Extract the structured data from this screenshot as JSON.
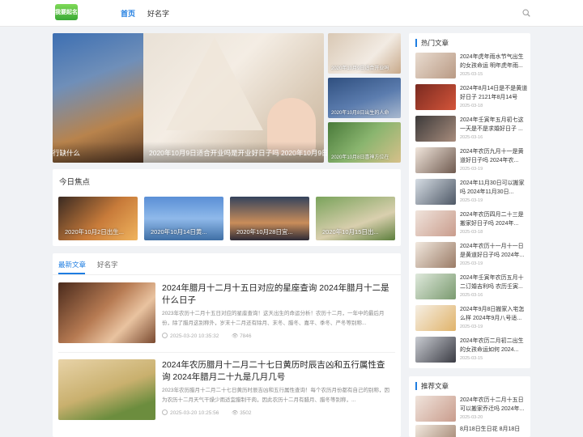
{
  "header": {
    "logo_text": "我要起名",
    "nav": [
      {
        "label": "首页",
        "active": true
      },
      {
        "label": "好名字",
        "active": false
      }
    ]
  },
  "slider": {
    "main_caption_left": "行缺什么",
    "main_caption_right": "2020年10月9日适合开业吗是开业好日子吗 2020年10月9日",
    "thumbs": [
      "2020年10月9日适合开业吗",
      "2020年10月8日出生的人命",
      "2020年10月8日喜神方位在"
    ]
  },
  "focus": {
    "title": "今日焦点",
    "cards": [
      "2020年10月2日出生...",
      "2020年10月14日黄...",
      "2020年10月28日宜...",
      "2020年10月15日出..."
    ]
  },
  "article_list": {
    "tabs": [
      {
        "label": "最新文章",
        "active": true
      },
      {
        "label": "好名字",
        "active": false
      }
    ],
    "articles": [
      {
        "title": "2024年腊月十二月十五日对应的星座查询 2024年腊月十二是什么日子",
        "desc": "2023年农历十二月十五日对应的星座查询！这天出生的命运分析！农历十二月，一年中的最后月份，除了腊月这别称外，岁末十二月还有除月、末冬、腊冬、嘉平、季冬、严冬等别称...",
        "date": "2025-03-20 10:35:32",
        "views": "7846"
      },
      {
        "title": "2024年农历腊月十二月二十七日黄历时辰吉凶和五行属性查询 2024年腊月二十九是几月几号",
        "desc": "2023年农历腊月十二月二十七日黄历时辰吉凶和五行属性查询！每个农历月份都有自己的别称，因为农历十二月天气干燥少雨适宜腊制干肉，因此农历十二月有腊月、腊冬等别称，...",
        "date": "2025-03-20 10:25:56",
        "views": "3502"
      }
    ]
  },
  "sidebar_hot": {
    "title": "热门文章",
    "items": [
      {
        "title": "2024年虎年雨水节气出生的女孩命运 明年虎年雨...",
        "date": "2025-03-15"
      },
      {
        "title": "2024年8月14日是不是黄道好日子 2121年8月14号",
        "date": "2025-03-18"
      },
      {
        "title": "2024年壬寅年五月初七这一天是不是求婚好日子 ...",
        "date": "2025-03-16"
      },
      {
        "title": "2024年农历九月十一是黄道好日子吗 2024年农...",
        "date": "2025-03-19"
      },
      {
        "title": "2024年11月30日可以搬家吗 2024年11月30日...",
        "date": "2025-03-19"
      },
      {
        "title": "2024年农历四月二十三是搬家好日子吗 2024年...",
        "date": "2025-03-18"
      },
      {
        "title": "2024年农历十一月十一日是黄道好日子吗 2024年...",
        "date": "2025-03-19"
      },
      {
        "title": "2024年壬寅年农历五月十二订婚吉利吗 农历壬寅...",
        "date": "2025-03-16"
      },
      {
        "title": "2024年9月8日搬家入宅怎么样 2024年9月八号适...",
        "date": "2025-03-19"
      },
      {
        "title": "2024年农历二月初二出生的女孩命运如何 2024...",
        "date": "2025-03-15"
      }
    ]
  },
  "sidebar_rec": {
    "title": "推荐文章",
    "items": [
      {
        "title": "2024年农历十二月十五日可以搬家乔迁吗 2024年...",
        "date": "2025-03-20"
      },
      {
        "title": "8月18日生日花 8月18日",
        "date": ""
      }
    ]
  },
  "colors": {
    "accent": "#1e7de1",
    "background": "#f0f2f5"
  }
}
